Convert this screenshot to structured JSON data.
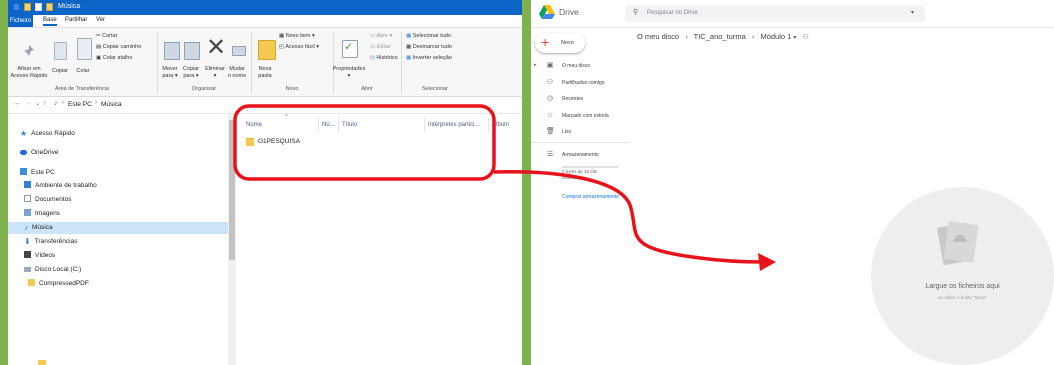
{
  "explorer": {
    "title": "Música",
    "tabs": [
      "Ficheiro",
      "Base",
      "Partilhar",
      "Ver"
    ],
    "ribbon": {
      "pin_label": "Afixar em\nAcesso Rápido",
      "copy_label": "Copiar",
      "paste_label": "Colar",
      "cut_label": "Cortar",
      "copy_path_label": "Copiar caminho",
      "paste_shortcut_label": "Colar atalho",
      "clipboard_group": "Área de Transferência",
      "move_label": "Mover\npara ▾",
      "copyto_label": "Copiar\npara ▾",
      "delete_label": "Eliminar\n▾",
      "rename_label": "Mudar\no nome",
      "organize_group": "Organizar",
      "new_folder_label": "Nova\npasta",
      "new_item_label": "Novo item ▾",
      "easy_access_label": "Acesso fácil ▾",
      "new_group": "Novo",
      "properties_label": "Propriedades\n▾",
      "open_label": "Abrir ▾",
      "edit_label": "Editar",
      "history_label": "Histórico",
      "open_group": "Abrir",
      "select_all_label": "Selecionar tudo",
      "select_none_label": "Desmarcar tudo",
      "invert_label": "Inverter seleção",
      "select_group": "Selecionar"
    },
    "address": {
      "pc": "Este PC",
      "folder": "Música"
    },
    "nav": [
      "Acesso Rápido",
      "OneDrive",
      "Este PC",
      "Ambiente de trabalho",
      "Documentos",
      "Imagens",
      "Música",
      "Transferências",
      "Vídeos",
      "Disco Local (C:)",
      "CompressedPDF"
    ],
    "columns": [
      "Nome",
      "Nú...",
      "Título",
      "Intérpretes partici...",
      "Álbum"
    ],
    "files": [
      "G1PESQUISA"
    ]
  },
  "drive": {
    "app_name": "Drive",
    "search_placeholder": "Pesquisar no Drive",
    "new_label": "Novo",
    "breadcrumb": [
      "O meu disco",
      "TIC_ano_turma",
      "Módulo 1"
    ],
    "nav": [
      "O meu disco",
      "Partilhados comigo",
      "Recentes",
      "Marcado com estrela",
      "Lixo",
      "Armazenamento"
    ],
    "storage_text": "0 bytes de 15 GB\nutilizado(s)",
    "buy_storage": "Comprar armazenamento",
    "drop_title": "Largue os ficheiros aqui",
    "drop_subtitle": "ou utilize o botão \"Novo\""
  },
  "colors": {
    "background": "#7fb14d",
    "explorer_title_bar": "#0b64c6",
    "annotation": "#e8131a",
    "drive_blue": "#1a73e8"
  }
}
